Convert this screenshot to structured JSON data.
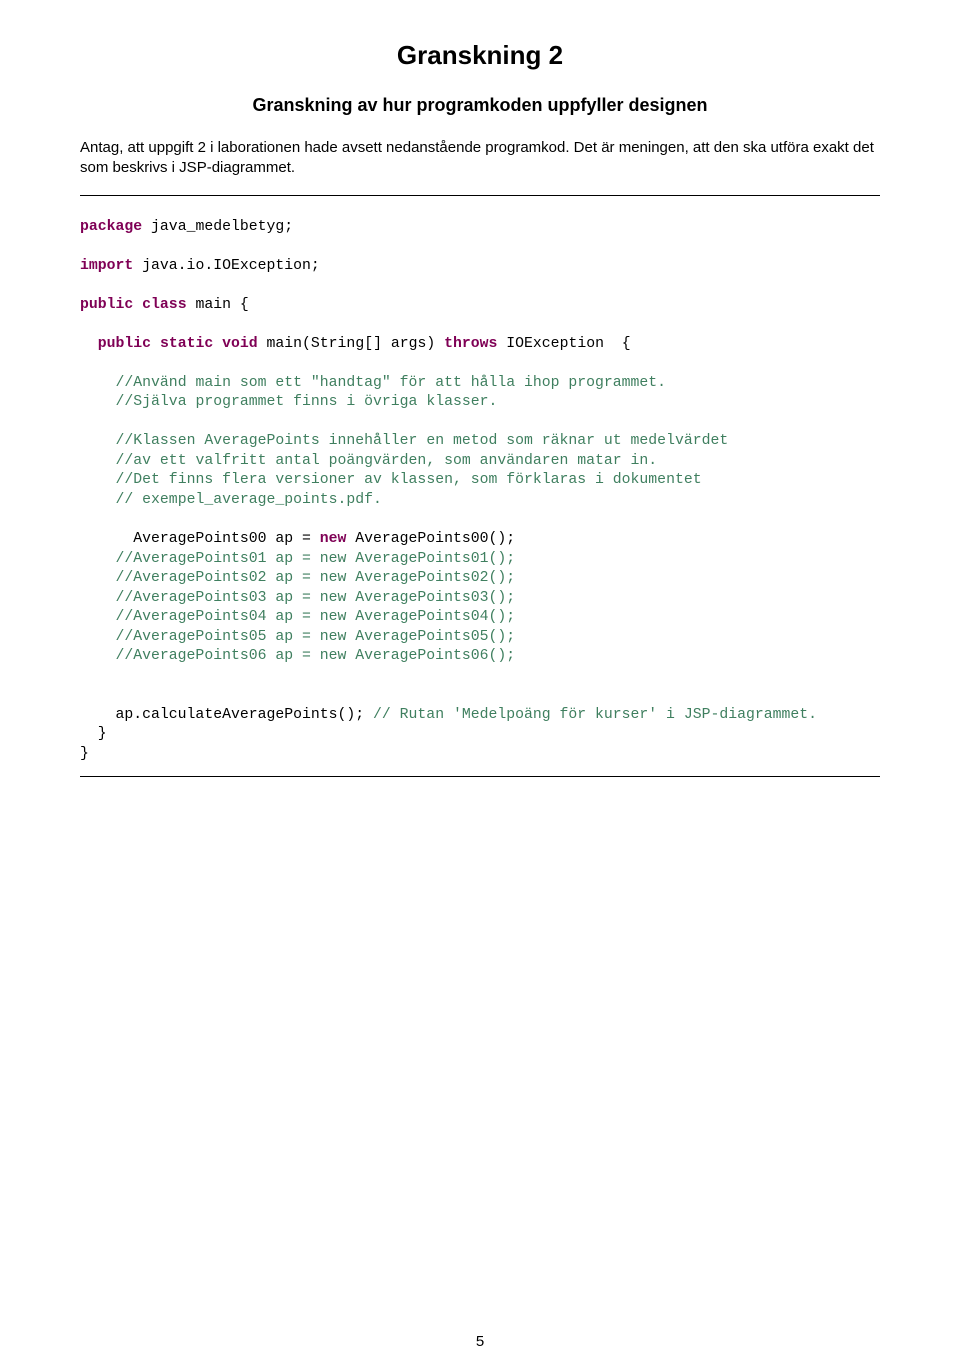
{
  "title": "Granskning 2",
  "subtitle": "Granskning av hur programkoden uppfyller designen",
  "intro": "Antag, att uppgift 2 i laborationen hade avsett nedanstående programkod. Det är meningen, att den ska utföra exakt det som beskrivs i JSP-diagrammet.",
  "code": {
    "kw_package": "package",
    "pkg_name": " java_medelbetyg;",
    "kw_import": "import",
    "import_name": " java.io.IOException;",
    "kw_public1": "public",
    "kw_class": "class",
    "class_name": " main {",
    "kw_public2": "public",
    "kw_static": "static",
    "kw_void": "void",
    "main_sig": " main(String[] args) ",
    "kw_throws": "throws",
    "throws_name": " IOException  {",
    "cm1": "//Använd main som ett \"handtag\" för att hålla ihop programmet.",
    "cm2": "//Själva programmet finns i övriga klasser.",
    "cm3": "//Klassen AveragePoints innehåller en metod som räknar ut medelvärdet",
    "cm4": "//av ett valfritt antal poängvärden, som användaren matar in.",
    "cm5": "//Det finns flera versioner av klassen, som förklaras i dokumentet",
    "cm6": "// exempel_average_points.pdf.",
    "line_ap_a": "      AveragePoints00 ap = ",
    "kw_new": "new",
    "line_ap_b": " AveragePoints00();",
    "cm_ap1": "    //AveragePoints01 ap = new AveragePoints01();",
    "cm_ap2": "    //AveragePoints02 ap = new AveragePoints02();",
    "cm_ap3": "    //AveragePoints03 ap = new AveragePoints03();",
    "cm_ap4": "    //AveragePoints04 ap = new AveragePoints04();",
    "cm_ap5": "    //AveragePoints05 ap = new AveragePoints05();",
    "cm_ap6": "    //AveragePoints06 ap = new AveragePoints06();",
    "call": "    ap.calculateAveragePoints(); ",
    "cm_call": "// Rutan 'Medelpoäng för kurser' i JSP-diagrammet.",
    "close1": "  }",
    "close2": "}"
  },
  "page_number": "5"
}
